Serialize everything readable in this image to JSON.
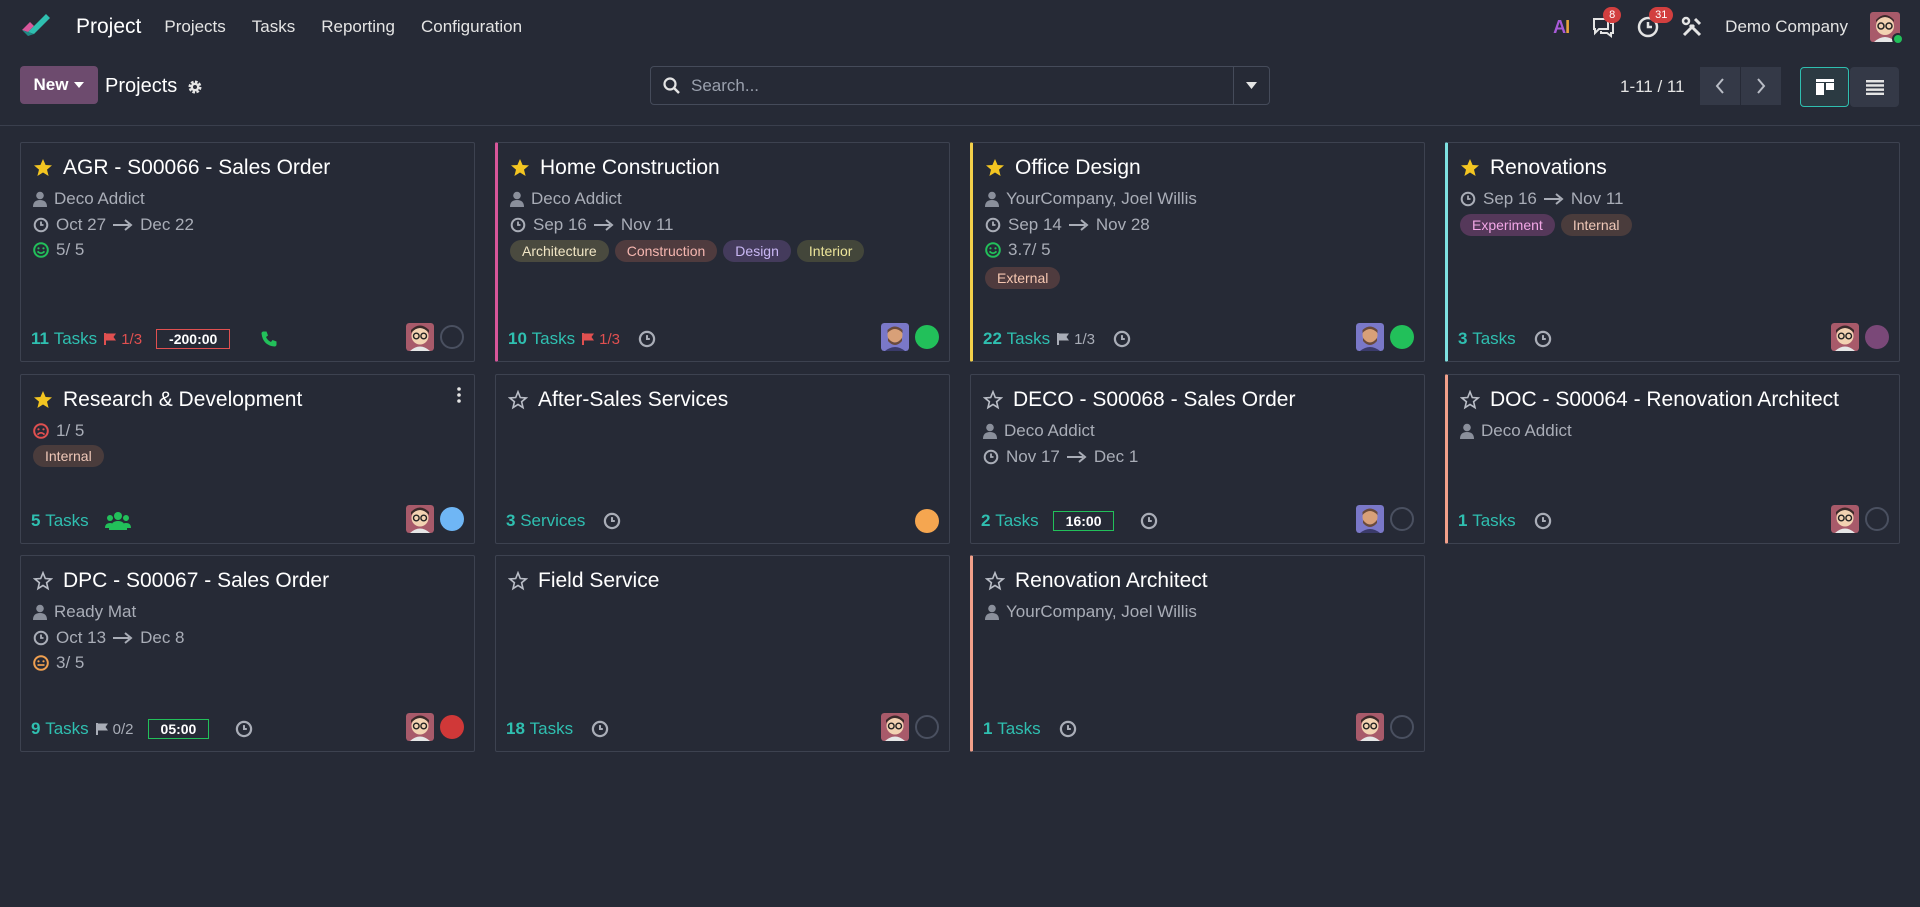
{
  "nav": {
    "app_title": "Project",
    "menu": [
      "Projects",
      "Tasks",
      "Reporting",
      "Configuration"
    ],
    "ai_label": "AI",
    "messages_count": "8",
    "activities_count": "31",
    "company": "Demo Company"
  },
  "control": {
    "new_label": "New",
    "page_title": "Projects",
    "search_placeholder": "Search...",
    "pager": "1-11 / 11"
  },
  "colors": {
    "accent": "#2fbfb0",
    "primary": "#6d4b6e",
    "danger": "#e05050",
    "success": "#22c05a",
    "star": "#f3c521"
  },
  "cards": [
    {
      "title": "AGR - S00066 - Sales Order",
      "favorite": true,
      "customer": "Deco Addict",
      "date_start": "Oct 27",
      "date_end": "Dec 22",
      "rating": "5/ 5",
      "tasks_count": "11",
      "tasks_label": "Tasks",
      "milestone": "1/3",
      "time": "-200:00",
      "status": "none"
    },
    {
      "title": "Home Construction",
      "favorite": true,
      "customer": "Deco Addict",
      "date_start": "Sep 16",
      "date_end": "Nov 11",
      "tags": [
        "Architecture",
        "Construction",
        "Design",
        "Interior"
      ],
      "tasks_count": "10",
      "tasks_label": "Tasks",
      "milestone": "1/3",
      "status": "green"
    },
    {
      "title": "Office Design",
      "favorite": true,
      "customer": "YourCompany, Joel Willis",
      "date_start": "Sep 14",
      "date_end": "Nov 28",
      "rating": "3.7/ 5",
      "tags": [
        "External"
      ],
      "tasks_count": "22",
      "tasks_label": "Tasks",
      "milestone": "1/3",
      "status": "green"
    },
    {
      "title": "Renovations",
      "favorite": true,
      "date_start": "Sep 16",
      "date_end": "Nov 11",
      "tags": [
        "Experiment",
        "Internal"
      ],
      "tasks_count": "3",
      "tasks_label": "Tasks",
      "status": "purple"
    },
    {
      "title": "Research & Development",
      "favorite": true,
      "rating": "1/ 5",
      "tags": [
        "Internal"
      ],
      "tasks_count": "5",
      "tasks_label": "Tasks",
      "status": "blue"
    },
    {
      "title": "After-Sales Services",
      "favorite": false,
      "tasks_count": "3",
      "tasks_label": "Services",
      "status": "orange"
    },
    {
      "title": "DECO - S00068 - Sales Order",
      "favorite": false,
      "customer": "Deco Addict",
      "date_start": "Nov 17",
      "date_end": "Dec 1",
      "tasks_count": "2",
      "tasks_label": "Tasks",
      "time": "16:00",
      "status": "none"
    },
    {
      "title": "DOC - S00064 - Renovation Architect",
      "favorite": false,
      "customer": "Deco Addict",
      "tasks_count": "1",
      "tasks_label": "Tasks",
      "status": "none"
    },
    {
      "title": "DPC - S00067 - Sales Order",
      "favorite": false,
      "customer": "Ready Mat",
      "date_start": "Oct 13",
      "date_end": "Dec 8",
      "rating": "3/ 5",
      "tasks_count": "9",
      "tasks_label": "Tasks",
      "milestone": "0/2",
      "time": "05:00",
      "status": "red"
    },
    {
      "title": "Field Service",
      "favorite": false,
      "tasks_count": "18",
      "tasks_label": "Tasks",
      "status": "none"
    },
    {
      "title": "Renovation Architect",
      "favorite": false,
      "customer": "YourCompany, Joel Willis",
      "tasks_count": "1",
      "tasks_label": "Tasks",
      "status": "none"
    }
  ]
}
